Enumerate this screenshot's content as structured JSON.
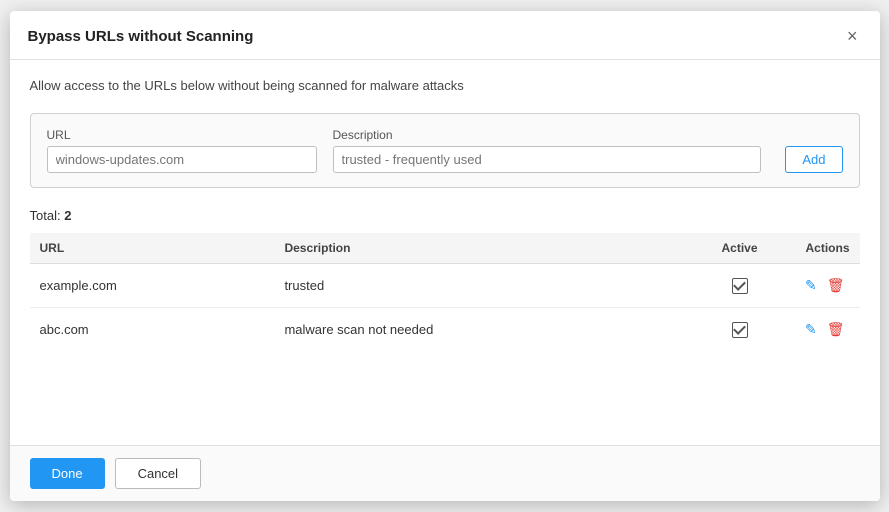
{
  "dialog": {
    "title": "Bypass URLs without Scanning",
    "description": "Allow access to the URLs below without being scanned for malware attacks",
    "close_label": "×"
  },
  "form": {
    "url_label": "URL",
    "url_placeholder": "windows-updates.com",
    "description_label": "Description",
    "description_placeholder": "trusted - frequently used",
    "add_button_label": "Add"
  },
  "table": {
    "total_label": "Total:",
    "total_count": "2",
    "columns": {
      "url": "URL",
      "description": "Description",
      "active": "Active",
      "actions": "Actions"
    },
    "rows": [
      {
        "url": "example.com",
        "description": "trusted",
        "active": true
      },
      {
        "url": "abc.com",
        "description": "malware scan not needed",
        "active": true
      }
    ]
  },
  "footer": {
    "done_label": "Done",
    "cancel_label": "Cancel"
  }
}
